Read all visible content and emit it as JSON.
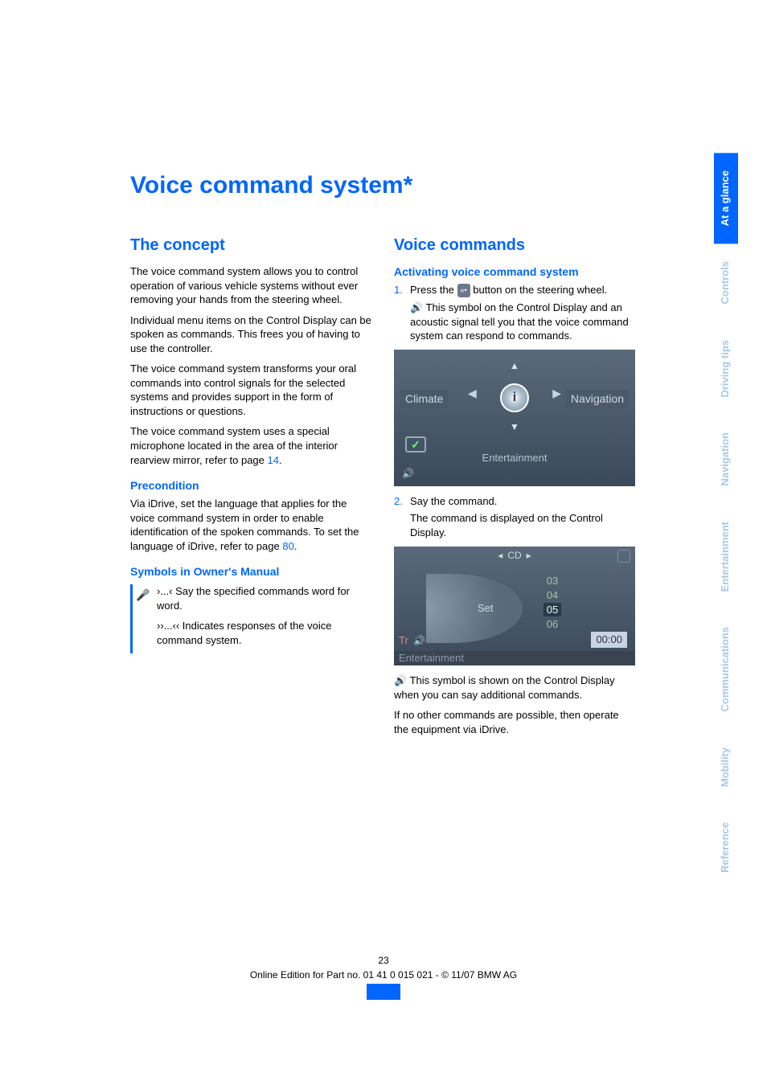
{
  "sideTabs": {
    "atAGlance": "At a glance",
    "controls": "Controls",
    "drivingTips": "Driving tips",
    "navigation": "Navigation",
    "entertainment": "Entertainment",
    "communications": "Communications",
    "mobility": "Mobility",
    "reference": "Reference"
  },
  "title": "Voice command system*",
  "left": {
    "h_concept": "The concept",
    "p1": "The voice command system allows you to control operation of various vehicle systems without ever removing your hands from the steering wheel.",
    "p2": "Individual menu items on the Control Display can be spoken as commands. This frees you of having to use the controller.",
    "p3": "The voice command system transforms your oral commands into control signals for the selected systems and provides support in the form of instructions or questions.",
    "p4a": "The voice command system uses a special microphone located in the area of the interior rearview mirror, refer to page ",
    "p4b": "14",
    "p4c": ".",
    "h_pre": "Precondition",
    "p5a": "Via iDrive, set the language that applies for the voice command system in order to enable identification of the spoken commands. To set the language of iDrive, refer to page ",
    "p5b": "80",
    "p5c": ".",
    "h_sym": "Symbols in Owner's Manual",
    "sym1": "›...‹ Say the specified commands word for word.",
    "sym2": "››...‹‹ Indicates responses of the voice command system."
  },
  "right": {
    "h_vc": "Voice commands",
    "h_act": "Activating voice command system",
    "step1a": "Press the ",
    "step1b": " button on the steering wheel.",
    "step1sub": " This symbol on the Control Display and an acoustic signal tell you that the voice command system can respond to commands.",
    "ds1": {
      "climate": "Climate",
      "navigation": "Navigation",
      "entertainment": "Entertainment",
      "center": "i"
    },
    "step2a": "Say the command.",
    "step2b": "The command is displayed on the Control Display.",
    "ds2": {
      "top": "CD",
      "set": "Set",
      "nums": [
        "03",
        "04",
        "05",
        "06"
      ],
      "time": "00:00",
      "tr": "Tr",
      "bottom": "Entertainment"
    },
    "after1": " This symbol is shown on the Control Display when you can say additional commands.",
    "after2": "If no other commands are possible, then operate the equipment via iDrive."
  },
  "footer": {
    "pageNum": "23",
    "line": "Online Edition for Part no. 01 41 0 015 021 - © 11/07 BMW AG"
  }
}
